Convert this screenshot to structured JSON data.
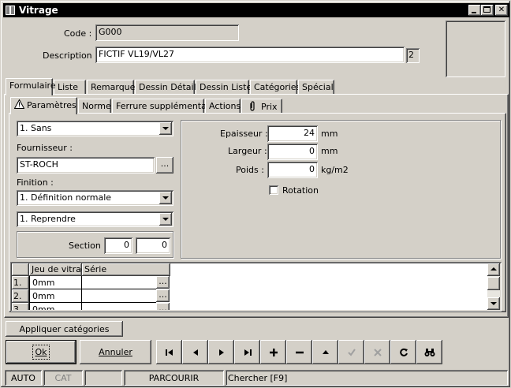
{
  "window": {
    "title": "Vitrage"
  },
  "header": {
    "code_label": "Code :",
    "code_value": "G000",
    "description_label": "Description :",
    "description_value": "FICTIF VL19/VL27",
    "description_badge": "2"
  },
  "main_tabs": [
    "Formulaire",
    "Liste",
    "Remarque",
    "Dessin Détail",
    "Dessin Liste",
    "Catégories",
    "Spécial"
  ],
  "sub_tabs": [
    "Paramètres",
    "Norme",
    "Ferrure supplémentaire",
    "Actions",
    "Prix"
  ],
  "left": {
    "type_value": "1.  Sans",
    "fournisseur_label": "Fournisseur :",
    "fournisseur_value": "ST-ROCH",
    "browse_label": "...",
    "finition_label": "Finition :",
    "finition_value": "1.  Définition normale",
    "reprendre_value": "1.  Reprendre",
    "section_label": "Section :",
    "section_value_1": "0",
    "section_value_2": "0"
  },
  "right": {
    "epaisseur_label": "Epaisseur :",
    "epaisseur_value": "24",
    "epaisseur_unit": "mm",
    "largeur_label": "Largeur :",
    "largeur_value": "0",
    "largeur_unit": "mm",
    "poids_label": "Poids :",
    "poids_value": "0",
    "poids_unit": "kg/m2",
    "rotation_label": "Rotation",
    "rotation_checked": false
  },
  "grid": {
    "columns": [
      "Jeu de vitrage",
      "Série"
    ],
    "rows": [
      {
        "num": "1.",
        "jeu": "0mm",
        "serie": "",
        "btn": "..."
      },
      {
        "num": "2.",
        "jeu": "0mm",
        "serie": "",
        "btn": "..."
      },
      {
        "num": "3.",
        "jeu": "0mm",
        "serie": "",
        "btn": "..."
      }
    ]
  },
  "buttons": {
    "appliquer": "Appliquer catégories",
    "ok": "Ok",
    "annuler": "Annuler"
  },
  "toolbar_icons": [
    "first-icon",
    "prev-icon",
    "next-icon",
    "last-icon",
    "plus-icon",
    "minus-icon",
    "up-icon",
    "check-icon",
    "cancel-x-icon",
    "refresh-icon",
    "binoculars-icon"
  ],
  "status": {
    "mode": "AUTO",
    "cat": "CAT",
    "empty": "",
    "state": "PARCOURIR",
    "hint": "Chercher [F9]"
  }
}
